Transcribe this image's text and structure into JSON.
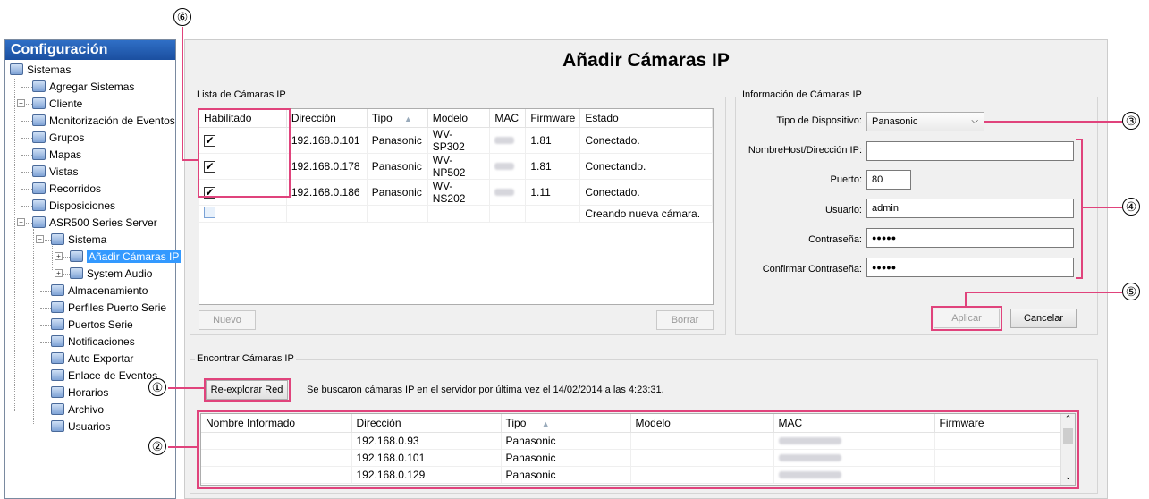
{
  "sidebar": {
    "title": "Configuración",
    "items": [
      {
        "label": "Sistemas",
        "icon": "systems-icon"
      },
      {
        "label": "Agregar Sistemas",
        "icon": "add-system-icon"
      },
      {
        "label": "Cliente",
        "icon": "client-gear-icon"
      },
      {
        "label": "Monitorización de Eventos",
        "icon": "event-monitor-icon"
      },
      {
        "label": "Grupos",
        "icon": "groups-icon"
      },
      {
        "label": "Mapas",
        "icon": "maps-icon"
      },
      {
        "label": "Vistas",
        "icon": "views-icon"
      },
      {
        "label": "Recorridos",
        "icon": "tours-icon"
      },
      {
        "label": "Disposiciones",
        "icon": "layouts-icon"
      },
      {
        "label": "ASR500 Series Server",
        "icon": "server-icon"
      },
      {
        "label": "Sistema",
        "icon": "system-icon"
      },
      {
        "label": "Añadir Cámaras IP",
        "icon": "add-camera-icon"
      },
      {
        "label": "System Audio",
        "icon": "audio-icon"
      },
      {
        "label": "Almacenamiento",
        "icon": "storage-icon"
      },
      {
        "label": "Perfiles Puerto Serie",
        "icon": "serial-profile-icon"
      },
      {
        "label": "Puertos Serie",
        "icon": "serial-port-icon"
      },
      {
        "label": "Notificaciones",
        "icon": "notifications-icon"
      },
      {
        "label": "Auto Exportar",
        "icon": "auto-export-icon"
      },
      {
        "label": "Enlace de Eventos",
        "icon": "event-link-icon"
      },
      {
        "label": "Horarios",
        "icon": "schedules-icon"
      },
      {
        "label": "Archivo",
        "icon": "archive-icon"
      },
      {
        "label": "Usuarios",
        "icon": "users-icon"
      }
    ]
  },
  "page_title": "Añadir Cámaras IP",
  "camera_list": {
    "legend": "Lista de Cámaras IP",
    "columns": [
      "Habilitado",
      "Dirección",
      "Tipo",
      "Modelo",
      "MAC",
      "Firmware",
      "Estado"
    ],
    "sort_icon": "▲",
    "rows": [
      {
        "enabled": "✔",
        "address": "192.168.0.101",
        "type": "Panasonic",
        "model": "WV-SP302",
        "firmware": "1.81",
        "status": "Conectado."
      },
      {
        "enabled": "✔",
        "address": "192.168.0.178",
        "type": "Panasonic",
        "model": "WV-NP502",
        "firmware": "1.81",
        "status": "Conectando."
      },
      {
        "enabled": "✔",
        "address": "192.168.0.186",
        "type": "Panasonic",
        "model": "WV-NS202",
        "firmware": "1.11",
        "status": "Conectado."
      },
      {
        "enabled": "",
        "address": "",
        "type": "",
        "model": "",
        "firmware": "",
        "status": "Creando nueva cámara."
      }
    ],
    "new_button": "Nuevo",
    "delete_button": "Borrar"
  },
  "camera_info": {
    "legend": "Información de Cámaras IP",
    "device_type_label": "Tipo de Dispositivo:",
    "device_type_value": "Panasonic",
    "hostname_label": "NombreHost/Dirección IP:",
    "hostname_value": "",
    "port_label": "Puerto:",
    "port_value": "80",
    "user_label": "Usuario:",
    "user_value": "admin",
    "password_label": "Contraseña:",
    "password_value": "●●●●●",
    "confirm_label": "Confirmar Contraseña:",
    "confirm_value": "●●●●●",
    "apply_button": "Aplicar",
    "cancel_button": "Cancelar"
  },
  "find_cameras": {
    "legend": "Encontrar Cámaras IP",
    "rescan_button": "Re-explorar Red",
    "last_scan_text": "Se buscaron cámaras IP en el servidor por última vez el 14/02/2014 a las 4:23:31.",
    "columns": [
      "Nombre Informado",
      "Dirección",
      "Tipo",
      "Modelo",
      "MAC",
      "Firmware"
    ],
    "sort_icon": "▲",
    "rows": [
      {
        "name": "",
        "address": "192.168.0.93",
        "type": "Panasonic",
        "model": "",
        "firmware": ""
      },
      {
        "name": "",
        "address": "192.168.0.101",
        "type": "Panasonic",
        "model": "",
        "firmware": ""
      },
      {
        "name": "",
        "address": "192.168.0.129",
        "type": "Panasonic",
        "model": "",
        "firmware": ""
      }
    ]
  },
  "callouts": [
    "①",
    "②",
    "③",
    "④",
    "⑤",
    "⑥"
  ],
  "colors": {
    "highlight": "#e0437c",
    "selection": "#3399ff",
    "title_bar": "#1b4fa0"
  }
}
